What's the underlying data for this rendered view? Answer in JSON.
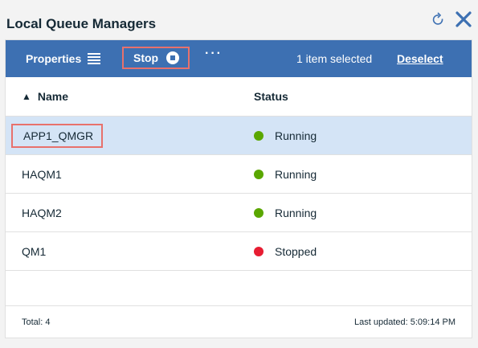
{
  "title": "Local Queue Managers",
  "toolbar": {
    "properties_label": "Properties",
    "stop_label": "Stop",
    "more_label": "···",
    "selected_text": "1 item selected",
    "deselect_label": "Deselect",
    "accent_color": "#3d70b2"
  },
  "table": {
    "sort_arrow": "▲",
    "columns": {
      "name": "Name",
      "status": "Status"
    },
    "rows": [
      {
        "name": "APP1_QMGR",
        "status": "Running",
        "status_color": "#5aa700",
        "selected": true
      },
      {
        "name": "HAQM1",
        "status": "Running",
        "status_color": "#5aa700",
        "selected": false
      },
      {
        "name": "HAQM2",
        "status": "Running",
        "status_color": "#5aa700",
        "selected": false
      },
      {
        "name": "QM1",
        "status": "Stopped",
        "status_color": "#e71d32",
        "selected": false
      }
    ]
  },
  "footer": {
    "total": "Total: 4",
    "last_updated": "Last updated: 5:09:14 PM"
  },
  "icons": {
    "refresh": "refresh-icon",
    "close": "close-icon",
    "menu": "hamburger-icon",
    "stop": "stop-icon"
  }
}
